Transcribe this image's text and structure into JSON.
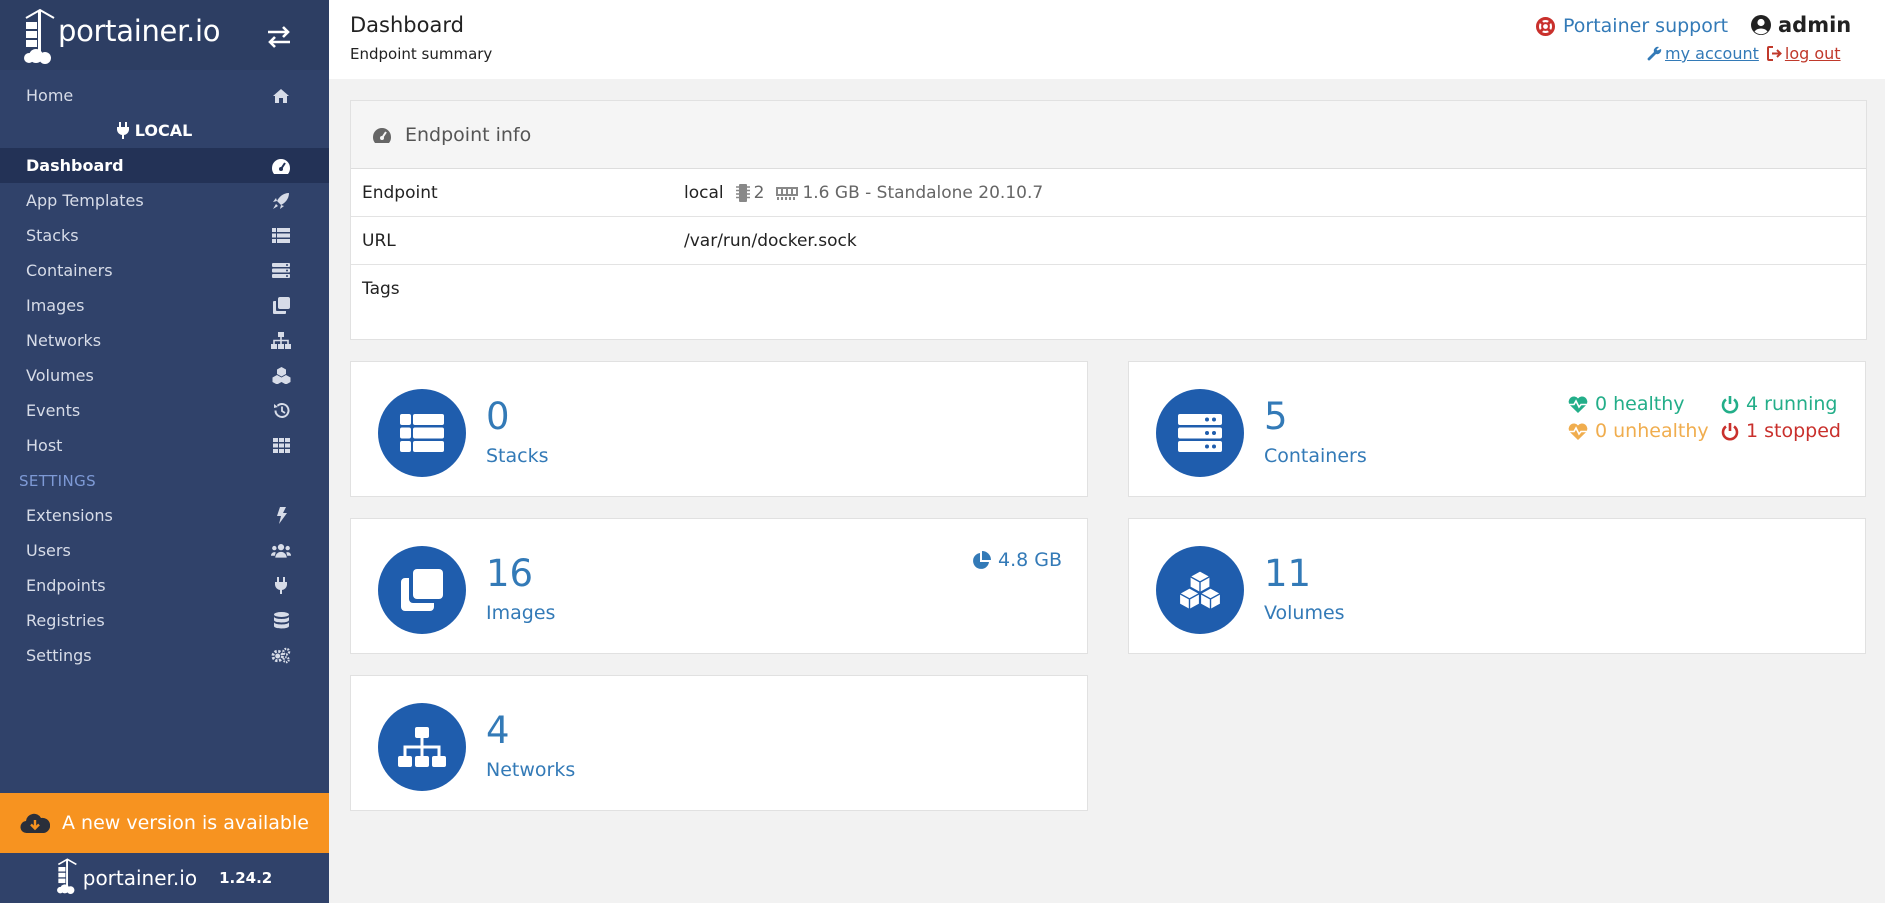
{
  "brand": {
    "name": "portainer.io"
  },
  "nav": {
    "home": "Home",
    "group": "LOCAL",
    "items": [
      {
        "label": "Dashboard",
        "icon": "tachometer-icon",
        "active": true
      },
      {
        "label": "App Templates",
        "icon": "rocket-icon"
      },
      {
        "label": "Stacks",
        "icon": "list-icon"
      },
      {
        "label": "Containers",
        "icon": "server-icon"
      },
      {
        "label": "Images",
        "icon": "clone-icon"
      },
      {
        "label": "Networks",
        "icon": "sitemap-icon"
      },
      {
        "label": "Volumes",
        "icon": "cubes-icon"
      },
      {
        "label": "Events",
        "icon": "history-icon"
      },
      {
        "label": "Host",
        "icon": "th-icon"
      }
    ],
    "settings_heading": "SETTINGS",
    "settings_items": [
      {
        "label": "Extensions",
        "icon": "bolt-icon"
      },
      {
        "label": "Users",
        "icon": "users-icon"
      },
      {
        "label": "Endpoints",
        "icon": "plug-icon"
      },
      {
        "label": "Registries",
        "icon": "database-icon"
      },
      {
        "label": "Settings",
        "icon": "cogs-icon"
      }
    ]
  },
  "update_banner": "A new version is available",
  "footer": {
    "name": "portainer.io",
    "version": "1.24.2"
  },
  "header": {
    "title": "Dashboard",
    "subtitle": "Endpoint summary",
    "support": "Portainer support",
    "user": "admin",
    "my_account": "my account",
    "log_out": "log out"
  },
  "endpoint_info": {
    "title": "Endpoint info",
    "rows": {
      "endpoint_label": "Endpoint",
      "endpoint_name": "local",
      "cpu": "2",
      "memory_info": "1.6 GB - Standalone 20.10.7",
      "url_label": "URL",
      "url": "/var/run/docker.sock",
      "tags_label": "Tags"
    }
  },
  "widgets": {
    "stacks": {
      "count": "0",
      "label": "Stacks"
    },
    "containers": {
      "count": "5",
      "label": "Containers",
      "healthy": "0 healthy",
      "unhealthy": "0 unhealthy",
      "running": "4 running",
      "stopped": "1 stopped"
    },
    "images": {
      "count": "16",
      "label": "Images",
      "size": "4.8 GB"
    },
    "volumes": {
      "count": "11",
      "label": "Volumes"
    },
    "networks": {
      "count": "4",
      "label": "Networks"
    }
  },
  "colors": {
    "sidebar": "#30426a",
    "accent": "#337ab7",
    "widget_circle": "#1f5dad",
    "banner": "#f79320",
    "healthy": "#23ae89",
    "unhealthy": "#f0ad4e",
    "stopped": "#c9302c"
  }
}
